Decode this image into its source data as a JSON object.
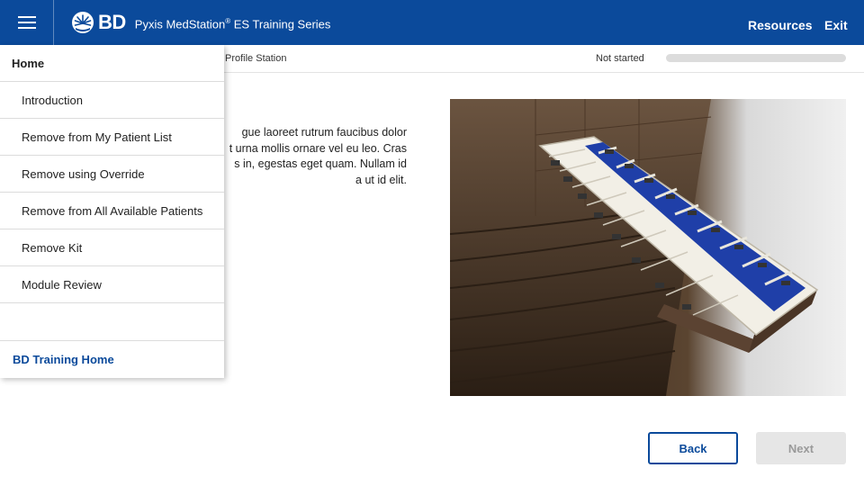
{
  "header": {
    "brand_name": "BD",
    "title": "Pyxis MedStation",
    "title_mark": "®",
    "title_suffix": " ES Training Series",
    "links": {
      "resources": "Resources",
      "exit": "Exit"
    },
    "color": "#0b4a9b"
  },
  "subheader": {
    "breadcrumb": "Profile Station",
    "status": "Not started",
    "progress_percent": 0
  },
  "content": {
    "body_lines": [
      "gue laoreet rutrum faucibus dolor",
      "t urna mollis ornare vel eu leo. Cras",
      "s in, egestas eget quam. Nullam id",
      "a ut id elit."
    ]
  },
  "side_menu": {
    "home": "Home",
    "items": [
      "Introduction",
      "Remove from My Patient List",
      "Remove using Override",
      "Remove from All Available Patients",
      "Remove Kit",
      "Module Review"
    ],
    "training_home": "BD Training Home"
  },
  "navigation": {
    "back": "Back",
    "next": "Next"
  },
  "icons": {
    "menu": "hamburger-menu-icon",
    "logo": "bd-starburst-logo-icon"
  }
}
